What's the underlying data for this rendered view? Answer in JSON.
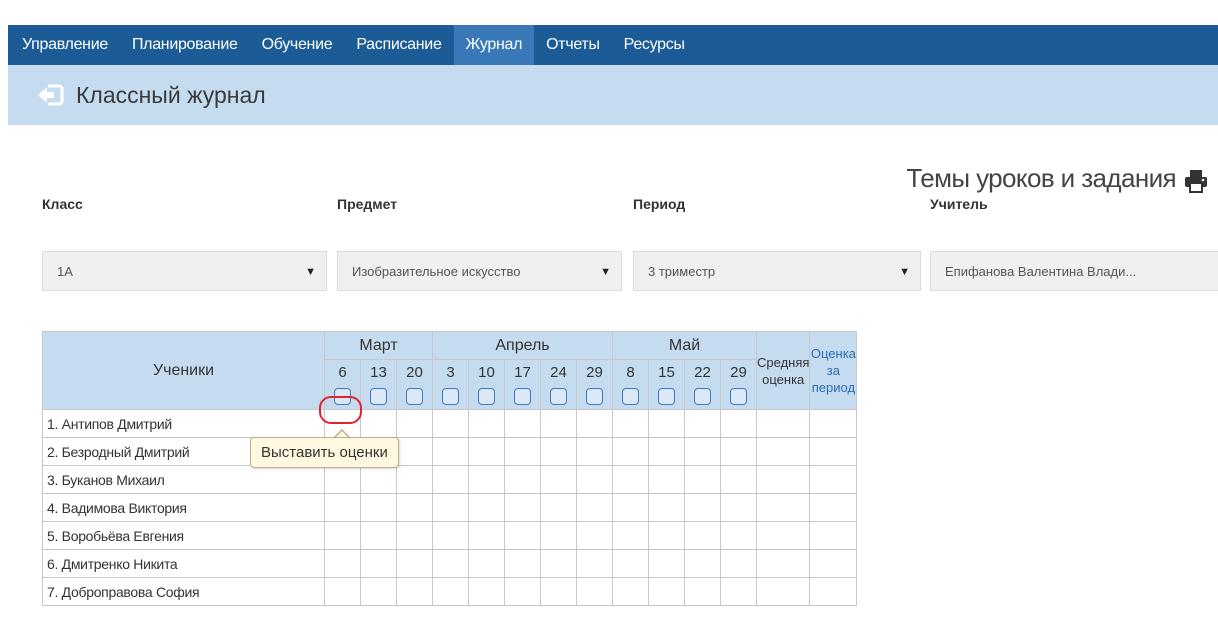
{
  "nav": {
    "items": [
      {
        "label": "Управление",
        "active": false
      },
      {
        "label": "Планирование",
        "active": false
      },
      {
        "label": "Обучение",
        "active": false
      },
      {
        "label": "Расписание",
        "active": false
      },
      {
        "label": "Журнал",
        "active": true
      },
      {
        "label": "Отчеты",
        "active": false
      },
      {
        "label": "Ресурсы",
        "active": false
      }
    ]
  },
  "header": {
    "title": "Классный журнал",
    "back_icon": "back-arrow-icon"
  },
  "section": {
    "title": "Темы уроков и задания",
    "print_icon": "printer-icon"
  },
  "filters": {
    "class": {
      "label": "Класс",
      "value": "1А"
    },
    "subject": {
      "label": "Предмет",
      "value": "Изобразительное искусство"
    },
    "period": {
      "label": "Период",
      "value": "3 триместр"
    },
    "teacher": {
      "label": "Учитель",
      "value": "Епифанова Валентина Влади..."
    }
  },
  "table": {
    "students_header": "Ученики",
    "months": [
      {
        "name": "Март",
        "dates": [
          "6",
          "13",
          "20"
        ]
      },
      {
        "name": "Апрель",
        "dates": [
          "3",
          "10",
          "17",
          "24",
          "29"
        ]
      },
      {
        "name": "Май",
        "dates": [
          "8",
          "15",
          "22",
          "29"
        ]
      }
    ],
    "avg_header": "Средняя оценка",
    "period_header": "Оценка за период",
    "students": [
      "1. Антипов Дмитрий",
      "2. Безродный Дмитрий",
      "3. Буканов Михаил",
      "4. Вадимова Виктория",
      "5. Воробьёва Евгения",
      "6. Дмитренко Никита",
      "7. Доброправова София"
    ]
  },
  "tooltip": {
    "text": "Выставить оценки"
  },
  "colors": {
    "nav_bg": "#1c5c96",
    "nav_active": "#3a79b8",
    "header_bg": "#c5dcf0",
    "highlight": "#e0242b",
    "link": "#2b6cb0"
  }
}
